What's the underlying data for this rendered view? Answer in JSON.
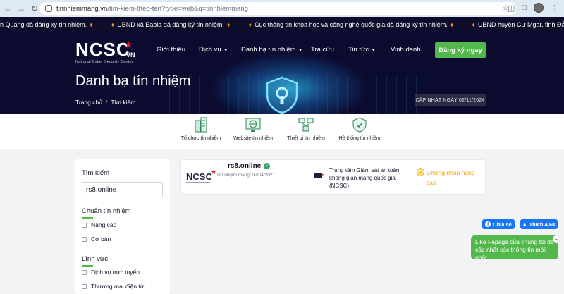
{
  "browser": {
    "url_domain": "tinnhiemmang.vn",
    "url_path": "/tim-kiem-theo-ten?type=web&q=tinnhiemmang"
  },
  "ticker": [
    "h Quang đã đăng ký tín nhiệm.",
    "UBND xã Eabia đã đăng ký tín nhiệm.",
    "Cục thông tin khoa học và công nghệ quốc gia đã đăng ký tín nhiệm.",
    "UBND huyện Cư Mgar, tỉnh Đắk Lắk đã đ"
  ],
  "logo": {
    "main": "NCSC",
    "suffix": "VN",
    "subtitle": "National Cyber Security Center"
  },
  "nav": {
    "items": [
      "Giới thiệu",
      "Dịch vụ",
      "Danh bạ tín nhiệm",
      "Tra cứu",
      "Tin tức",
      "Vinh danh"
    ],
    "register_label": "Đăng ký ngay"
  },
  "hero": {
    "title": "Danh bạ tín nhiệm",
    "breadcrumb_home": "Trang chủ",
    "breadcrumb_current": "Tìm kiếm",
    "breadcrumb_sep": "/",
    "update_badge": "CẬP NHẬT NGÀY 02/11/2024"
  },
  "categories": [
    "Tổ chức tín nhiệm",
    "Website tín nhiệm",
    "Thiết bị tín nhiệm",
    "Hệ thống tín nhiệm"
  ],
  "sidebar": {
    "search_label": "Tìm kiếm",
    "search_value": "rs8.online",
    "standard_label": "Chuẩn tín nhiệm",
    "standard_options": [
      "Nâng cao",
      "Cơ bản"
    ],
    "field_label": "Lĩnh vực",
    "field_options": [
      "Dịch vụ trực tuyến",
      "Thương mại điện tử"
    ]
  },
  "result": {
    "logo_text": "NCSC",
    "name": "rs8.online",
    "date": "Tín nhiệm mạng: 07/04/2021",
    "org": "Trung tâm Giám sát an toàn không gian mạng quốc gia (NCSC)",
    "cert": "Chứng nhận nâng cao"
  },
  "social": {
    "share_label": "Chia sẻ",
    "like_label": "Thích 4,6K",
    "fanpage_text": "Like Fapage của chúng tôi để cập nhật các thông tin mới nhất"
  },
  "colors": {
    "brand_green": "#52b84c",
    "dark_navy": "#0b0b30",
    "cert_orange": "#f2a60f",
    "facebook_blue": "#1877f2"
  }
}
